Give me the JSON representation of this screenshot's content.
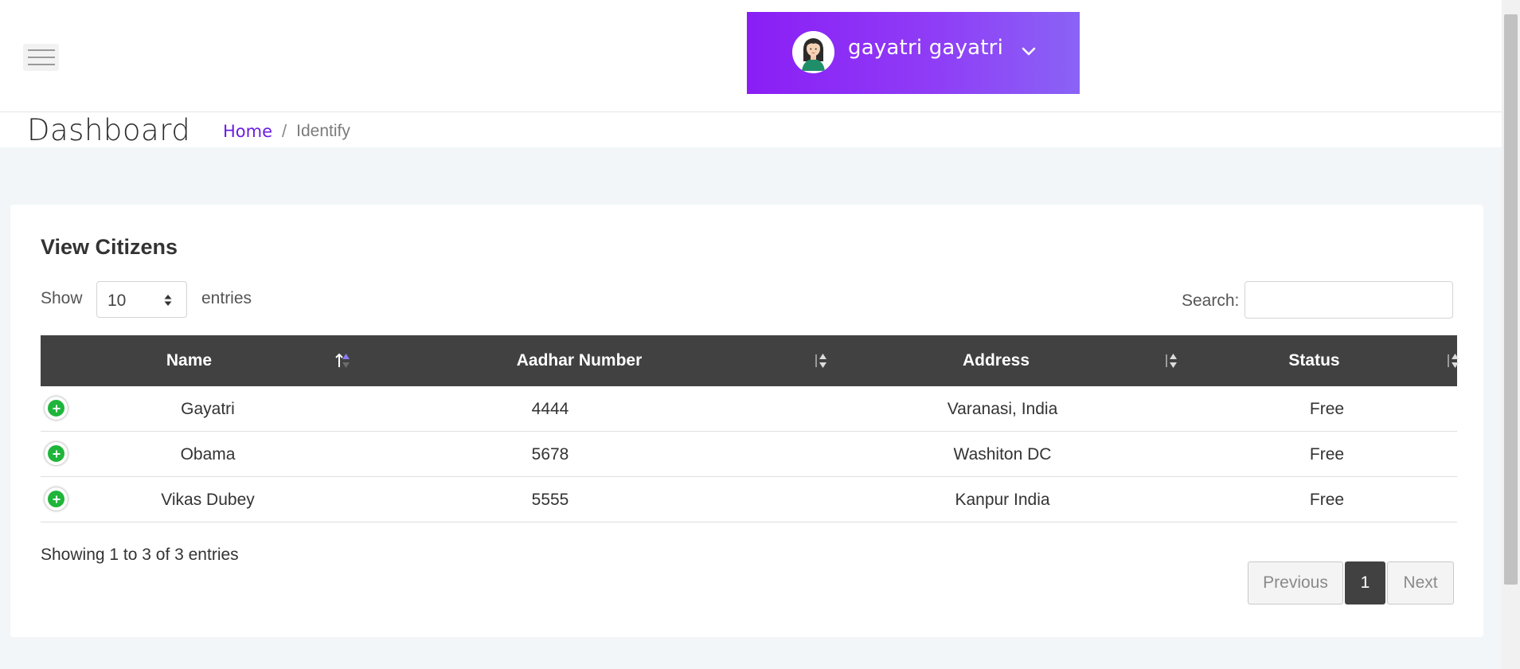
{
  "header": {
    "menu_icon": "hamburger-menu-icon",
    "user": {
      "name": "gayatri gayatri",
      "avatar_icon": "user-avatar-icon",
      "dropdown_icon": "chevron-down-icon",
      "gradient": [
        "#8a1ef5",
        "#8a63f6"
      ]
    }
  },
  "page": {
    "title": "Dashboard",
    "breadcrumb": {
      "home": "Home",
      "separator": "/",
      "current": "Identify"
    }
  },
  "card": {
    "title": "View Citizens",
    "length": {
      "show_label": "Show",
      "value": "10",
      "entries_label": "entries"
    },
    "search": {
      "label": "Search:",
      "value": "",
      "placeholder": ""
    }
  },
  "table": {
    "header_bg": "#414141",
    "columns": [
      "Name",
      "Aadhar Number",
      "Address",
      "Status"
    ],
    "sorted_column": "Name",
    "rows": [
      {
        "name": "Gayatri",
        "aadhar": "4444",
        "address": "Varanasi, India",
        "status": "Free"
      },
      {
        "name": "Obama",
        "aadhar": "5678",
        "address": "Washiton DC",
        "status": "Free"
      },
      {
        "name": "Vikas Dubey",
        "aadhar": "5555",
        "address": "Kanpur India",
        "status": "Free"
      }
    ],
    "expand_icon": "plus-circle-icon",
    "expand_color": "#1fb53a"
  },
  "footer": {
    "info": "Showing 1 to 3 of 3 entries",
    "pagination": {
      "previous": "Previous",
      "current_page": "1",
      "next": "Next"
    }
  },
  "colors": {
    "accent": "#6a1ee0",
    "content_bg": "#f2f6f8"
  }
}
